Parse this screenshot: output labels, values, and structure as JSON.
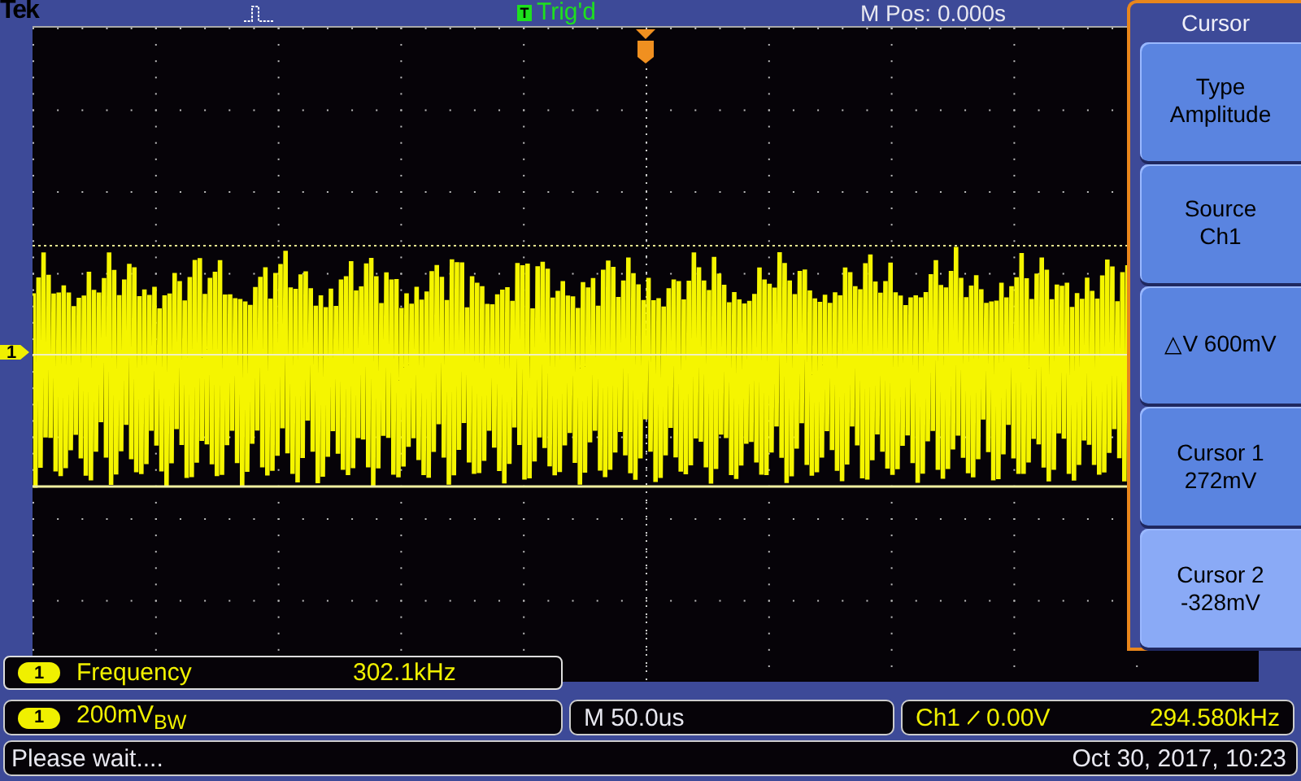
{
  "header": {
    "brand": "Tek",
    "trigger_badge": "T",
    "trigger_status": "Trig'd",
    "position": "M Pos: 0.000s"
  },
  "channel_marker": "1",
  "menu": {
    "title": "Cursor",
    "items": [
      {
        "label": "Type",
        "value": "Amplitude",
        "selected": false
      },
      {
        "label": "Source",
        "value": "Ch1",
        "selected": false
      },
      {
        "label": "△V 600mV",
        "selected": false
      },
      {
        "label": "Cursor 1",
        "value": "272mV",
        "selected": false
      },
      {
        "label": "Cursor 2",
        "value": "-328mV",
        "selected": true
      }
    ]
  },
  "measurement": {
    "channel": "1",
    "name": "Frequency",
    "value": "302.1kHz"
  },
  "channel_readout": {
    "channel": "1",
    "scale": "200mV$_{BW}$"
  },
  "timebase": "M 50.0us",
  "trigger": {
    "source": "Ch1",
    "level": "0.00V",
    "frequency": "294.580kHz"
  },
  "status": {
    "message": "Please wait....",
    "datetime": "Oct 30, 2017, 10:23"
  }
}
